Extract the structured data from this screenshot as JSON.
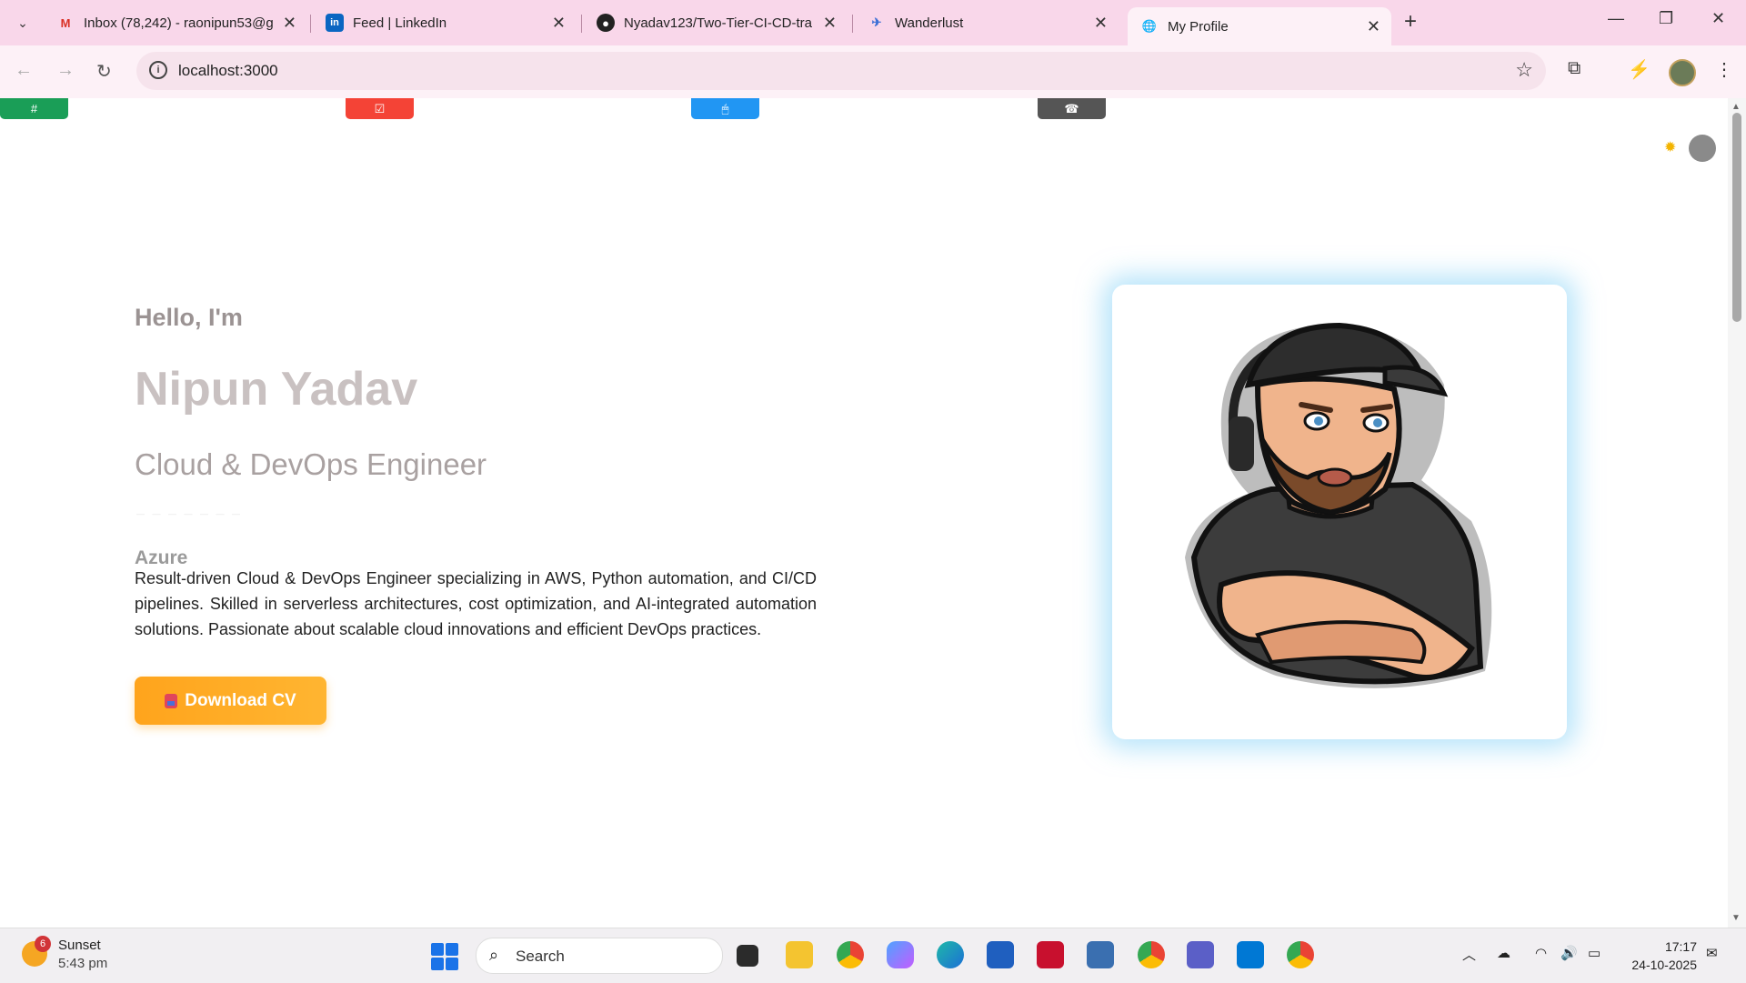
{
  "browser": {
    "tabs": [
      {
        "title": "Inbox (78,242) - raonipun53@g",
        "icon": "gmail-icon",
        "color": "#d93025"
      },
      {
        "title": "Feed | LinkedIn",
        "icon": "linkedin-icon",
        "color": "#0a66c2"
      },
      {
        "title": "Nyadav123/Two-Tier-CI-CD-tra",
        "icon": "github-icon",
        "color": "#222222"
      },
      {
        "title": "Wanderlust",
        "icon": "compass-icon",
        "color": "#3b6fd6"
      },
      {
        "title": "My Profile",
        "icon": "globe-icon",
        "color": "#555555"
      }
    ],
    "url": "localhost:3000"
  },
  "nav": {
    "pills": [
      {
        "glyph": "#",
        "color": "#1a9e57"
      },
      {
        "glyph": "☑",
        "color": "#f44336"
      },
      {
        "glyph": "🖱",
        "color": "#2196f3"
      },
      {
        "glyph": "☎",
        "color": "#555555"
      }
    ]
  },
  "hero": {
    "greeting": "Hello, I'm",
    "name": "Nipun Yadav",
    "role": "Cloud & DevOps Engineer",
    "typing_skill": "Azure",
    "description": "Result-driven Cloud & DevOps Engineer specializing in AWS, Python automation, and CI/CD pipelines. Skilled in serverless architectures, cost optimization, and AI-integrated automation solutions. Passionate about scalable cloud innovations and efficient DevOps practices.",
    "cv_button": "Download CV"
  },
  "taskbar": {
    "weather_title": "Sunset",
    "weather_time": "5:43 pm",
    "weather_badge": "6",
    "search_placeholder": "Search",
    "time": "17:17",
    "date": "24-10-2025"
  }
}
